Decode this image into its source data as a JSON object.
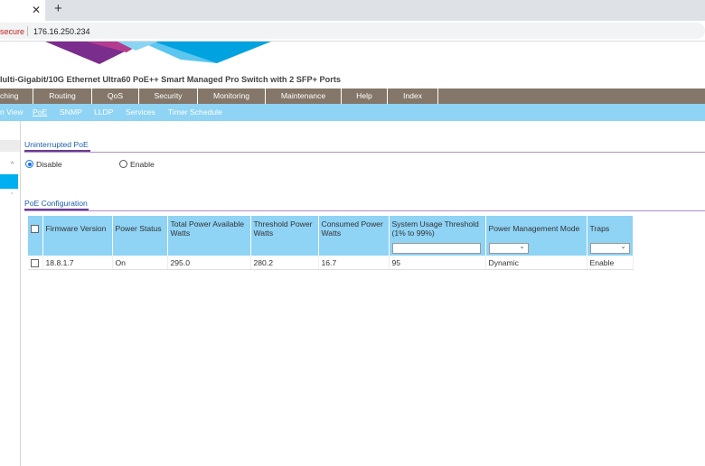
{
  "browser": {
    "close_glyph": "✕",
    "newtab_glyph": "+",
    "security_text": "secure",
    "url": "176.16.250.234"
  },
  "product_title": "lulti-Gigabit/10G Ethernet Ultra60 PoE++ Smart Managed Pro Switch with 2 SFP+ Ports",
  "main_nav": [
    "ching",
    "Routing",
    "QoS",
    "Security",
    "Monitoring",
    "Maintenance",
    "Help",
    "Index"
  ],
  "sub_nav": [
    "n View",
    "PoE",
    "SNMP",
    "LLDP",
    "Services",
    "Timer Schedule"
  ],
  "sub_nav_active": "PoE",
  "sidebar": {
    "caret_up": "^",
    "caret_down": "ˇ"
  },
  "uninterrupted_poe": {
    "title": "Uninterrupted PoE",
    "options": [
      {
        "label": "Disable",
        "selected": true
      },
      {
        "label": "Enable",
        "selected": false
      }
    ]
  },
  "poe_config": {
    "title": "PoE Configuration",
    "columns": [
      "Firmware Version",
      "Power Status",
      "Total Power Available Watts",
      "Threshold Power Watts",
      "Consumed Power Watts",
      "System Usage Threshold (1% to 99%)",
      "Power Management Mode",
      "Traps"
    ],
    "rows": [
      [
        "18.8.1.7",
        "On",
        "295.0",
        "280.2",
        "16.7",
        "95",
        "Dynamic",
        "Enable"
      ]
    ]
  },
  "colors": {
    "nav": "#847769",
    "subnav": "#8fd3f5",
    "accent": "#00aff0",
    "section_underline": "#6b3b92"
  }
}
